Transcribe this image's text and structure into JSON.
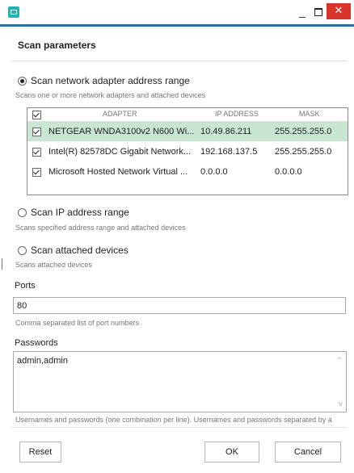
{
  "window": {
    "minimize_glyph": "_",
    "close_glyph": "✕",
    "accent_color": "#2c6f9e",
    "close_color": "#d9342b"
  },
  "dialog": {
    "title": "Scan parameters"
  },
  "options": {
    "adapter_range": {
      "label": "Scan network adapter address range",
      "hint": "Scans one or more network adapters and attached devices",
      "selected": true
    },
    "ip_range": {
      "label": "Scan IP address range",
      "hint": "Scans specified address range and attached devices",
      "selected": false
    },
    "attached_devices": {
      "label": "Scan attached devices",
      "hint": "Scans attached devices",
      "selected": false
    }
  },
  "adapters": {
    "columns": {
      "adapter": "ADAPTER",
      "ip": "IP ADDRESS",
      "mask": "MASK"
    },
    "all_checked": true,
    "rows": [
      {
        "name": "NETGEAR WNDA3100v2 N600 Wi...",
        "ip": "10.49.86.211",
        "mask": "255.255.255.0",
        "checked": true,
        "selected": true
      },
      {
        "name": "Intel(R) 82578DC Gigabit Network...",
        "ip": "192.168.137.5",
        "mask": "255.255.255.0",
        "checked": true,
        "selected": false
      },
      {
        "name": "Microsoft Hosted Network Virtual ...",
        "ip": "0.0.0.0",
        "mask": "0.0.0.0",
        "checked": true,
        "selected": false
      }
    ],
    "selected_row_color": "#c9e6d2"
  },
  "ports": {
    "label": "Ports",
    "value": "80",
    "hint": "Comma separated list of port numbers"
  },
  "passwords": {
    "label": "Passwords",
    "value": "admin,admin",
    "hint": "Usernames and passwords (one combination per line). Usernames and passwords separated by a"
  },
  "buttons": {
    "reset": "Reset",
    "ok": "OK",
    "cancel": "Cancel"
  }
}
